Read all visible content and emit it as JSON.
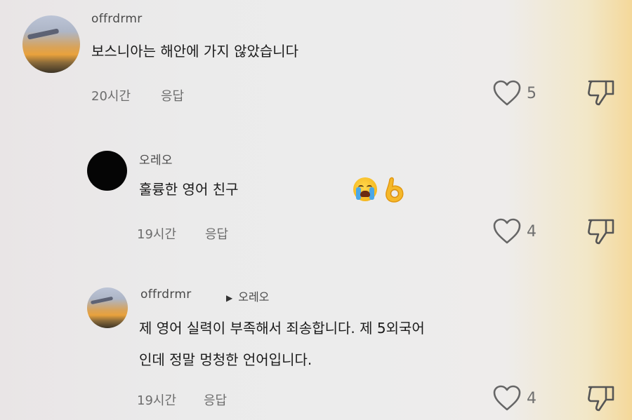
{
  "comments": [
    {
      "username": "offrdrmr",
      "text": "보스니아는 해안에 가지 않았습니다",
      "time": "20시간",
      "reply_label": "응답",
      "likes": "5"
    },
    {
      "username": "오레오",
      "text": "훌륭한 영어 친구",
      "time": "19시간",
      "reply_label": "응답",
      "likes": "4",
      "emojis": [
        "loudly-crying-face",
        "ok-hand"
      ]
    },
    {
      "username": "offrdrmr",
      "reply_to": "오레오",
      "text_line1": "제 영어 실력이 부족해서 죄송합니다. 제 5외국어",
      "text_line2": "인데 정말 멍청한 언어입니다.",
      "time": "19시간",
      "reply_label": "응답",
      "likes": "4"
    }
  ]
}
